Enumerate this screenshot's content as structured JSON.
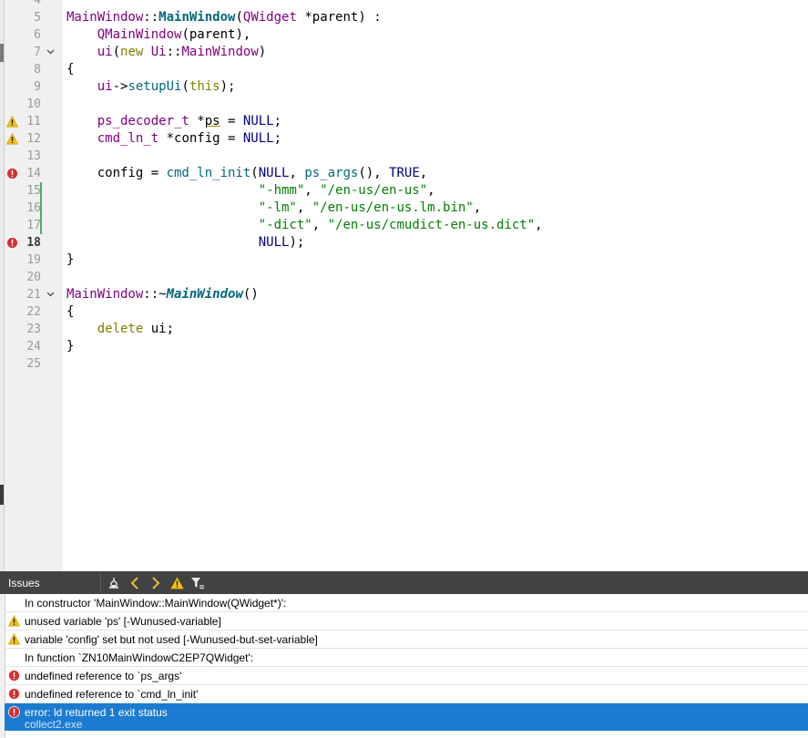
{
  "editor": {
    "lines": [
      {
        "n": "4",
        "segs": []
      },
      {
        "n": "5",
        "segs": [
          {
            "t": "MainWindow",
            "c": "ty"
          },
          {
            "t": "::",
            "c": ""
          },
          {
            "t": "MainWindow",
            "c": "fnb"
          },
          {
            "t": "(",
            "c": ""
          },
          {
            "t": "QWidget",
            "c": "ty"
          },
          {
            "t": " *parent) :",
            "c": ""
          }
        ]
      },
      {
        "n": "6",
        "segs": [
          {
            "t": "    ",
            "c": ""
          },
          {
            "t": "QMainWindow",
            "c": "ty"
          },
          {
            "t": "(parent),",
            "c": ""
          }
        ]
      },
      {
        "n": "7",
        "fold": true,
        "segs": [
          {
            "t": "    ",
            "c": ""
          },
          {
            "t": "ui",
            "c": "ty"
          },
          {
            "t": "(",
            "c": ""
          },
          {
            "t": "new",
            "c": "kw"
          },
          {
            "t": " ",
            "c": ""
          },
          {
            "t": "Ui",
            "c": "ty"
          },
          {
            "t": "::",
            "c": ""
          },
          {
            "t": "MainWindow",
            "c": "ty"
          },
          {
            "t": ")",
            "c": ""
          }
        ]
      },
      {
        "n": "8",
        "segs": [
          {
            "t": "{",
            "c": ""
          }
        ]
      },
      {
        "n": "9",
        "segs": [
          {
            "t": "    ",
            "c": ""
          },
          {
            "t": "ui",
            "c": "ty"
          },
          {
            "t": "->",
            "c": ""
          },
          {
            "t": "setupUi",
            "c": "fn"
          },
          {
            "t": "(",
            "c": ""
          },
          {
            "t": "this",
            "c": "kw"
          },
          {
            "t": ");",
            "c": ""
          }
        ]
      },
      {
        "n": "10",
        "segs": []
      },
      {
        "n": "11",
        "marker": "warning",
        "segs": [
          {
            "t": "    ",
            "c": ""
          },
          {
            "t": "ps_decoder_t",
            "c": "ty"
          },
          {
            "t": " *",
            "c": ""
          },
          {
            "t": "ps",
            "c": "ul"
          },
          {
            "t": " = ",
            "c": ""
          },
          {
            "t": "NULL",
            "c": "mc"
          },
          {
            "t": ";",
            "c": ""
          }
        ]
      },
      {
        "n": "12",
        "marker": "warning",
        "segs": [
          {
            "t": "    ",
            "c": ""
          },
          {
            "t": "cmd_ln_t",
            "c": "ty"
          },
          {
            "t": " *config = ",
            "c": ""
          },
          {
            "t": "NULL",
            "c": "mc"
          },
          {
            "t": ";",
            "c": ""
          }
        ]
      },
      {
        "n": "13",
        "segs": []
      },
      {
        "n": "14",
        "marker": "error",
        "segs": [
          {
            "t": "    config = ",
            "c": ""
          },
          {
            "t": "cmd_ln_init",
            "c": "fn"
          },
          {
            "t": "(",
            "c": ""
          },
          {
            "t": "NULL",
            "c": "mc"
          },
          {
            "t": ", ",
            "c": ""
          },
          {
            "t": "ps_args",
            "c": "fn"
          },
          {
            "t": "(), ",
            "c": ""
          },
          {
            "t": "TRUE",
            "c": "mc"
          },
          {
            "t": ",",
            "c": ""
          }
        ]
      },
      {
        "n": "15",
        "changed": true,
        "segs": [
          {
            "t": "                         ",
            "c": ""
          },
          {
            "t": "\"-hmm\"",
            "c": "st"
          },
          {
            "t": ", ",
            "c": ""
          },
          {
            "t": "\"/en-us/en-us\"",
            "c": "st"
          },
          {
            "t": ",",
            "c": ""
          }
        ]
      },
      {
        "n": "16",
        "changed": true,
        "segs": [
          {
            "t": "                         ",
            "c": ""
          },
          {
            "t": "\"-lm\"",
            "c": "st"
          },
          {
            "t": ", ",
            "c": ""
          },
          {
            "t": "\"/en-us/en-us.lm.bin\"",
            "c": "st"
          },
          {
            "t": ",",
            "c": ""
          }
        ]
      },
      {
        "n": "17",
        "changed": true,
        "segs": [
          {
            "t": "                         ",
            "c": ""
          },
          {
            "t": "\"-dict\"",
            "c": "st"
          },
          {
            "t": ", ",
            "c": ""
          },
          {
            "t": "\"/en-us/cmudict-en-us.dict\"",
            "c": "st"
          },
          {
            "t": ",",
            "c": ""
          }
        ]
      },
      {
        "n": "18",
        "marker": "error",
        "bold": true,
        "segs": [
          {
            "t": "                         ",
            "c": ""
          },
          {
            "t": "NULL",
            "c": "mc"
          },
          {
            "t": ");",
            "c": ""
          }
        ]
      },
      {
        "n": "19",
        "segs": [
          {
            "t": "}",
            "c": ""
          }
        ]
      },
      {
        "n": "20",
        "segs": []
      },
      {
        "n": "21",
        "fold": true,
        "segs": [
          {
            "t": "MainWindow",
            "c": "ty"
          },
          {
            "t": "::~",
            "c": ""
          },
          {
            "t": "MainWindow",
            "c": "fni"
          },
          {
            "t": "()",
            "c": ""
          }
        ]
      },
      {
        "n": "22",
        "segs": [
          {
            "t": "{",
            "c": ""
          }
        ]
      },
      {
        "n": "23",
        "segs": [
          {
            "t": "    ",
            "c": ""
          },
          {
            "t": "delete",
            "c": "kw"
          },
          {
            "t": " ui;",
            "c": ""
          }
        ]
      },
      {
        "n": "24",
        "segs": [
          {
            "t": "}",
            "c": ""
          }
        ]
      },
      {
        "n": "25",
        "segs": []
      }
    ]
  },
  "issues": {
    "title": "Issues",
    "items": [
      {
        "type": "none",
        "text": "In constructor 'MainWindow::MainWindow(QWidget*)':"
      },
      {
        "type": "warning",
        "text": "unused variable 'ps' [-Wunused-variable]"
      },
      {
        "type": "warning",
        "text": "variable 'config' set but not used [-Wunused-but-set-variable]"
      },
      {
        "type": "none",
        "text": "In function `ZN10MainWindowC2EP7QWidget':"
      },
      {
        "type": "error",
        "text": "undefined reference to `ps_args'"
      },
      {
        "type": "error",
        "text": "undefined reference to `cmd_ln_init'"
      },
      {
        "type": "error",
        "text": "error: ld returned 1 exit status",
        "sub": "collect2.exe",
        "selected": true
      }
    ]
  }
}
